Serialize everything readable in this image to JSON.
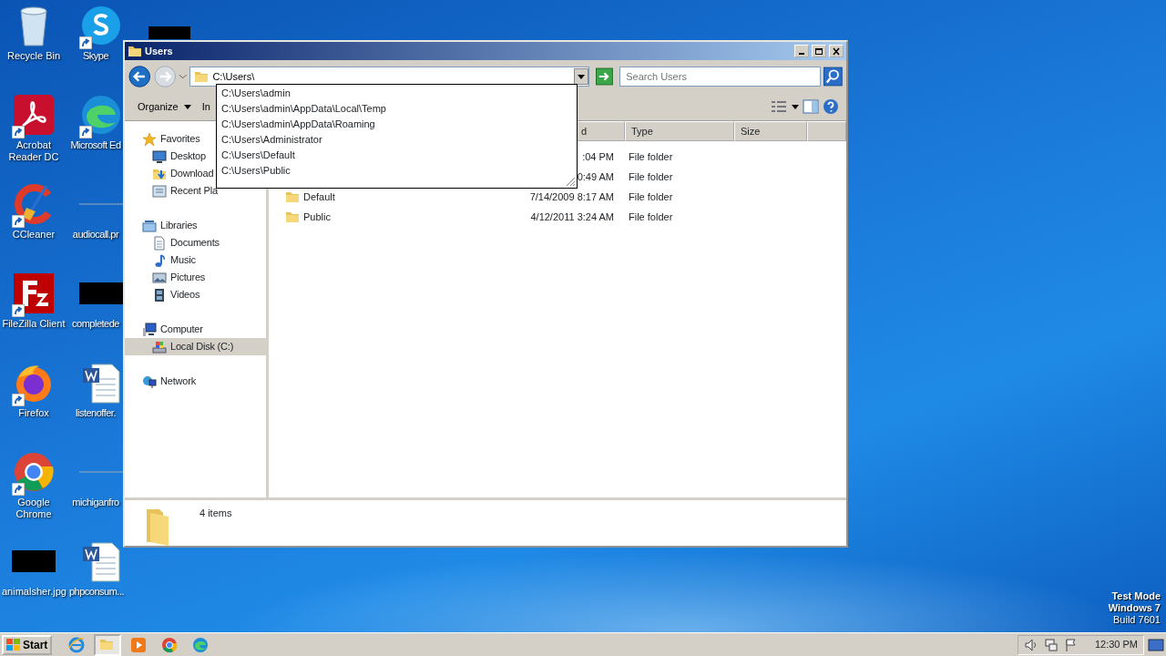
{
  "desktop_icons": [
    {
      "label": "Recycle Bin",
      "kind": "recycle",
      "shortcut": false
    },
    {
      "label": "Skype",
      "kind": "skype",
      "shortcut": true
    },
    {
      "label": "Acrobat Reader DC",
      "kind": "acrobat",
      "shortcut": true
    },
    {
      "label": "Microsoft Ed",
      "kind": "edge",
      "shortcut": true
    },
    {
      "label": "CCleaner",
      "kind": "ccleaner",
      "shortcut": true
    },
    {
      "label": "audiocall.pr",
      "kind": "blank",
      "shortcut": false
    },
    {
      "label": "FileZilla Client",
      "kind": "filezilla",
      "shortcut": true
    },
    {
      "label": "completede",
      "kind": "redacted",
      "shortcut": false
    },
    {
      "label": "Firefox",
      "kind": "firefox",
      "shortcut": true
    },
    {
      "label": "listenoffer.",
      "kind": "word",
      "shortcut": false
    },
    {
      "label": "Google Chrome",
      "kind": "chrome",
      "shortcut": true
    },
    {
      "label": "michiganfro",
      "kind": "blank",
      "shortcut": false
    },
    {
      "label": "animalsher.jpg",
      "kind": "redacted",
      "shortcut": false
    },
    {
      "label": "phpconsum...",
      "kind": "word",
      "shortcut": false
    }
  ],
  "window": {
    "title": "Users",
    "address": {
      "value": "C:\\Users\\"
    },
    "search": {
      "placeholder": "Search Users"
    },
    "toolbar": [
      {
        "label": "Organize",
        "dropdown": true
      },
      {
        "label": "In",
        "dropdown": false
      }
    ],
    "autocomplete": [
      "C:\\Users\\admin",
      "C:\\Users\\admin\\AppData\\Local\\Temp",
      "C:\\Users\\admin\\AppData\\Roaming",
      "C:\\Users\\Administrator",
      "C:\\Users\\Default",
      "C:\\Users\\Public"
    ],
    "nav": [
      {
        "label": "Favorites",
        "kind": "star",
        "selected": false,
        "children": [
          {
            "label": "Desktop",
            "kind": "desktop",
            "selected": false
          },
          {
            "label": "Download",
            "kind": "downloads",
            "selected": false
          },
          {
            "label": "Recent Pla",
            "kind": "recent",
            "selected": false
          }
        ]
      },
      {
        "label": "Libraries",
        "kind": "libraries",
        "selected": false,
        "children": [
          {
            "label": "Documents",
            "kind": "document",
            "selected": false
          },
          {
            "label": "Music",
            "kind": "music",
            "selected": false
          },
          {
            "label": "Pictures",
            "kind": "pictures",
            "selected": false
          },
          {
            "label": "Videos",
            "kind": "videos",
            "selected": false
          }
        ]
      },
      {
        "label": "Computer",
        "kind": "computer",
        "selected": false,
        "children": [
          {
            "label": "Local Disk (C:)",
            "kind": "disk",
            "selected": true
          }
        ]
      },
      {
        "label": "Network",
        "kind": "network",
        "selected": false
      }
    ],
    "columns": [
      "d",
      "Type",
      "Size"
    ],
    "rows": [
      {
        "date": ":04 PM",
        "type": "File folder"
      },
      {
        "date": "0:49 AM",
        "type": "File folder"
      },
      {
        "name": "Default",
        "date": "7/14/2009 8:17 AM",
        "type": "File folder"
      },
      {
        "name": "Public",
        "date": "4/12/2011 3:24 AM",
        "type": "File folder"
      }
    ],
    "status": "4 items"
  },
  "watermark": [
    "Test Mode",
    "Windows 7",
    "Build 7601"
  ],
  "taskbar": {
    "start": "Start",
    "apps": [
      {
        "kind": "ie",
        "active": false
      },
      {
        "kind": "explorer",
        "active": true
      },
      {
        "kind": "media",
        "active": false
      },
      {
        "kind": "chrome",
        "active": false
      },
      {
        "kind": "edge",
        "active": false
      }
    ],
    "clock": "12:30 PM"
  }
}
